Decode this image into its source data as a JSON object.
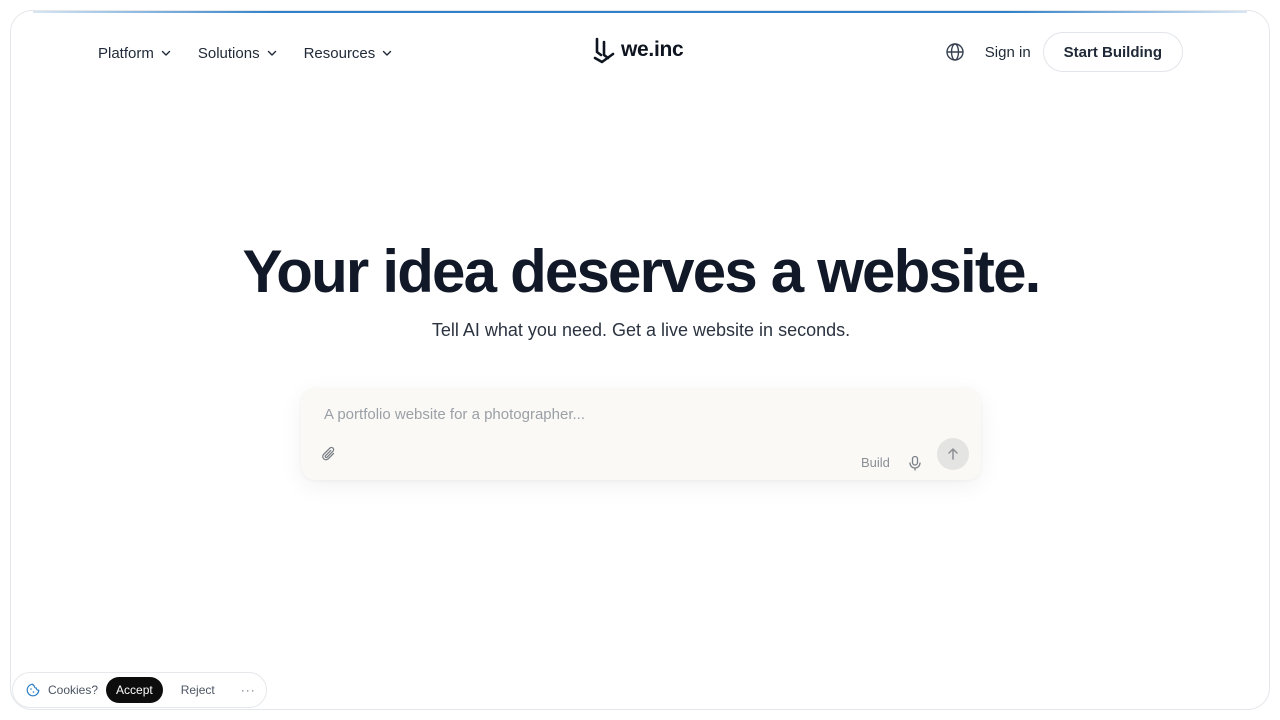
{
  "nav": {
    "items": [
      {
        "label": "Platform"
      },
      {
        "label": "Solutions"
      },
      {
        "label": "Resources"
      }
    ],
    "logo_text": "we.inc",
    "signin_label": "Sign in",
    "cta_label": "Start Building"
  },
  "hero": {
    "title": "Your idea deserves a website.",
    "subtitle": "Tell AI what you need. Get a live website in seconds."
  },
  "prompt": {
    "value": "",
    "placeholder": "A portfolio website for a photographer...",
    "build_label": "Build"
  },
  "cookies": {
    "label": "Cookies?",
    "accept_label": "Accept",
    "reject_label": "Reject",
    "more_label": "···"
  },
  "icons": {
    "chevron": "chevron-down-icon",
    "logo": "we-inc-logo-icon",
    "globe": "globe-icon",
    "attach": "paperclip-icon",
    "mic": "microphone-icon",
    "send": "arrow-up-icon",
    "cookie": "cookie-icon"
  },
  "colors": {
    "accent": "#2f80c8",
    "title": "#111827",
    "prompt_bg": "#faf9f6",
    "accept_bg": "#0d0d0d"
  }
}
